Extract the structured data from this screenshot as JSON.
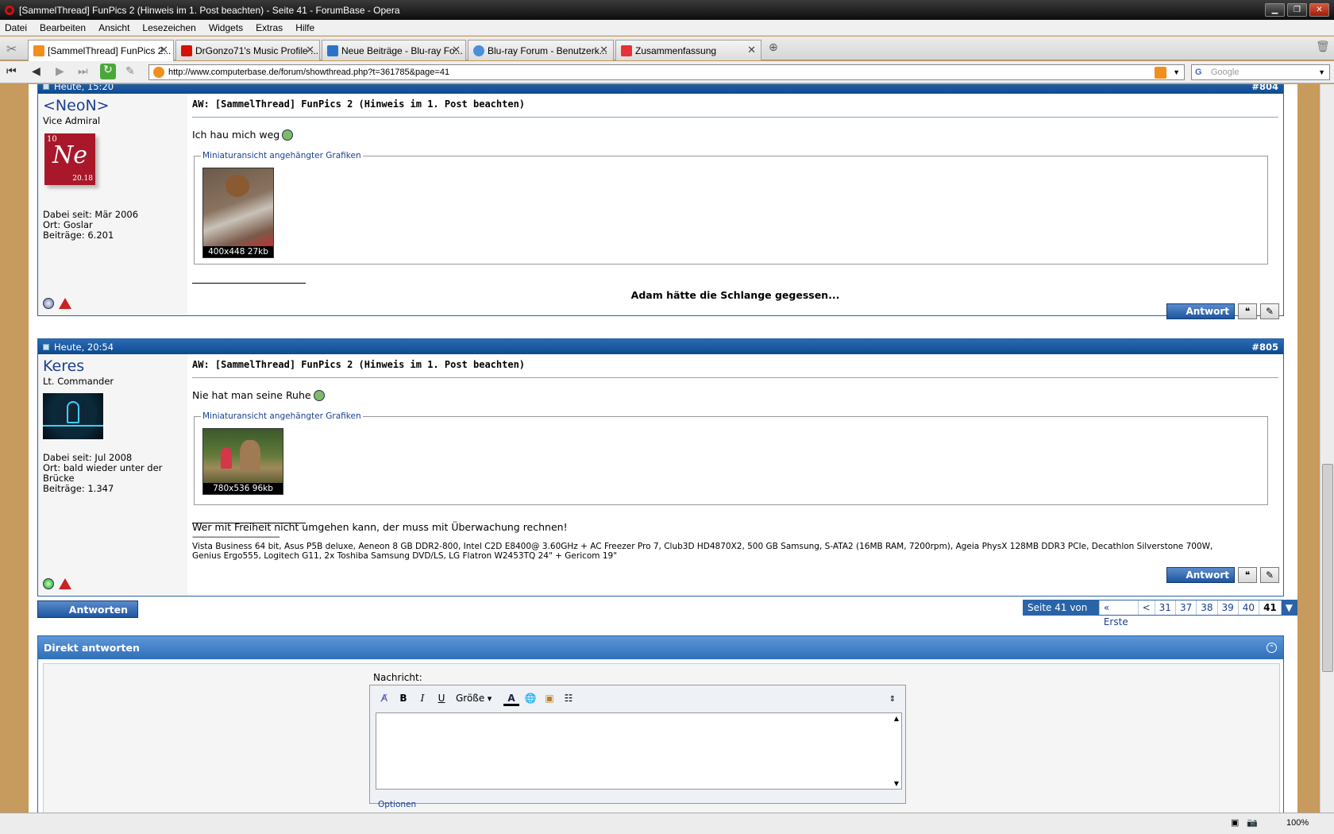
{
  "window": {
    "title": "[SammelThread] FunPics 2 (Hinweis im 1. Post beachten) - Seite 41 - ForumBase - Opera"
  },
  "menu": [
    "Datei",
    "Bearbeiten",
    "Ansicht",
    "Lesezeichen",
    "Widgets",
    "Extras",
    "Hilfe"
  ],
  "tabs": [
    {
      "label": "[SammelThread] FunPics 2...",
      "color": "#f08f1e"
    },
    {
      "label": "DrGonzo71's Music Profile ...",
      "color": "#d51007"
    },
    {
      "label": "Neue Beiträge - Blu-ray Fo...",
      "color": "#2a74c8"
    },
    {
      "label": "Blu-ray Forum - Benutzerk...",
      "color": "#4a90d9"
    },
    {
      "label": "Zusammenfassung",
      "color": "#e53238"
    }
  ],
  "address": {
    "url": "http://www.computerbase.de/forum/showthread.php?t=361785&page=41",
    "search_placeholder": "Google"
  },
  "posts": [
    {
      "date": "Heute, 15:20",
      "num": "#804",
      "user": "<NeoN>",
      "rank": "Vice Admiral",
      "avatar": {
        "top": "10",
        "main": "Ne",
        "sub": "20.18"
      },
      "joined": "Dabei seit: Mär 2006",
      "location": "Ort: Goslar",
      "count": "Beiträge: 6.201",
      "title": "AW: [SammelThread] FunPics 2 (Hinweis im 1. Post beachten)",
      "text": "Ich hau mich weg",
      "attach_label": "Miniaturansicht angehängter Grafiken",
      "thumb_cap": "400x448 27kb",
      "signature": "Adam hätte die Schlange gegessen..."
    },
    {
      "date": "Heute, 20:54",
      "num": "#805",
      "user": "Keres",
      "rank": "Lt. Commander",
      "joined": "Dabei seit: Jul 2008",
      "location": "Ort: bald wieder unter der Brücke",
      "count": "Beiträge: 1.347",
      "title": "AW: [SammelThread] FunPics 2 (Hinweis im 1. Post beachten)",
      "text": "Nie hat man seine Ruhe",
      "attach_label": "Miniaturansicht angehängter Grafiken",
      "thumb_cap": "780x536 96kb",
      "sig_quote": "Wer mit Freiheit nicht umgehen kann, der muss mit Überwachung rechnen!",
      "sig_dashes": "------------------------------------------",
      "sig_specs": "Vista Business 64 bit, Asus P5B deluxe, Aeneon 8 GB DDR2-800, Intel C2D E8400@ 3.60GHz + AC Freezer Pro 7, Club3D HD4870X2, 500 GB Samsung, S-ATA2 (16MB RAM, 7200rpm), Ageia PhysX 128MB DDR3 PCIe, Decathlon Silverstone 700W, Genius Ergo555, Logitech G11, 2x Toshiba Samsung DVD/LS, LG Flatron W2453TQ 24\" + Gericom 19\""
    }
  ],
  "reply_label": "Antwort",
  "reply_big_label": "Antworten",
  "pagination": {
    "label": "Seite 41 von 41",
    "first": "« Erste",
    "prev": "<",
    "pages": [
      "31",
      "37",
      "38",
      "39",
      "40"
    ],
    "current": "41"
  },
  "quickreply": {
    "title": "Direkt antworten",
    "message_label": "Nachricht:",
    "size_label": "Größe",
    "options_label": "Optionen"
  },
  "status": {
    "zoom": "100%"
  }
}
